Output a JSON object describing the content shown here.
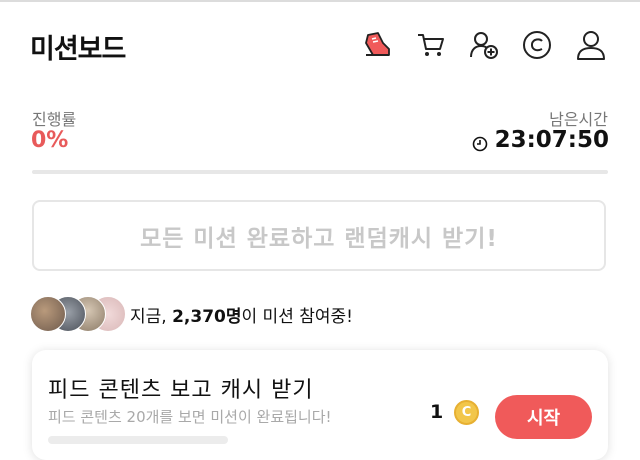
{
  "header": {
    "title": "미션보드",
    "icons": [
      "shoe-icon",
      "cart-icon",
      "add-friend-icon",
      "cash-coin-icon",
      "profile-icon"
    ]
  },
  "progress": {
    "label": "진행률",
    "value_text": "0%",
    "percent": 0
  },
  "remaining": {
    "label": "남은시간",
    "time": "23:07:50"
  },
  "reward_banner": {
    "text": "모든 미션 완료하고 랜덤캐시 받기!"
  },
  "participants": {
    "prefix": "지금, ",
    "count": "2,370명",
    "suffix": "이 미션 참여중!"
  },
  "missions": [
    {
      "title": "피드 콘텐츠 보고 캐시 받기",
      "description": "피드 콘텐츠 20개를 보면 미션이 완료됩니다!",
      "reward": "1",
      "coin_symbol": "C",
      "button": "시작"
    }
  ],
  "colors": {
    "accent": "#e85a5a",
    "button": "#f05a5a",
    "coin": "#f2c64a",
    "muted": "#c8c8c8"
  }
}
